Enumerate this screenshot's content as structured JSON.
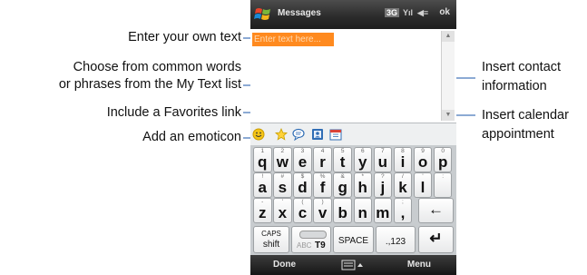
{
  "callouts": {
    "enter_text": "Enter your own text",
    "my_text_line1": "Choose from common words",
    "my_text_line2": "or phrases from the My Text list",
    "favorites": "Include a Favorites link",
    "emoticon": "Add an emoticon",
    "contact_line1": "Insert contact",
    "contact_line2": "information",
    "calendar_line1": "Insert calendar",
    "calendar_line2": "appointment"
  },
  "phone": {
    "title": "Messages",
    "network": "3G",
    "signal": "Yıl",
    "volume": "◀≡",
    "ok": "ok",
    "compose_placeholder": "Enter text here...",
    "done": "Done",
    "menu": "Menu"
  },
  "keyboard": {
    "row1": [
      {
        "alt": "1",
        "main": "q"
      },
      {
        "alt": "2",
        "main": "w"
      },
      {
        "alt": "3",
        "main": "e"
      },
      {
        "alt": "4",
        "main": "r"
      },
      {
        "alt": "5",
        "main": "t"
      },
      {
        "alt": "6",
        "main": "y"
      },
      {
        "alt": "7",
        "main": "u"
      },
      {
        "alt": "8",
        "main": "i"
      },
      {
        "alt": "9",
        "main": "o"
      },
      {
        "alt": "0",
        "main": "p"
      }
    ],
    "row2": [
      {
        "alt": "!",
        "main": "a"
      },
      {
        "alt": "#",
        "main": "s"
      },
      {
        "alt": "$",
        "main": "d"
      },
      {
        "alt": "%",
        "main": "f"
      },
      {
        "alt": "&",
        "main": "g"
      },
      {
        "alt": "*",
        "main": "h"
      },
      {
        "alt": "?",
        "main": "j"
      },
      {
        "alt": "/",
        "main": "k"
      },
      {
        "alt": "'",
        "main": "l"
      },
      {
        "alt": ":",
        "main": ""
      }
    ],
    "row3": [
      {
        "alt": "-",
        "main": "z"
      },
      {
        "alt": "'",
        "main": "x"
      },
      {
        "alt": "(",
        "main": "c"
      },
      {
        "alt": ")",
        "main": "v"
      },
      {
        "alt": "",
        "main": "b"
      },
      {
        "alt": "",
        "main": "n"
      },
      {
        "alt": "",
        "main": "m"
      },
      {
        "alt": ";",
        "main": ","
      }
    ],
    "caps_top": "CAPS",
    "caps_bottom": "shift",
    "abc_label": "ABC",
    "t9_label": "T9",
    "space": "SPACE",
    "num": ".,123",
    "backspace": "←",
    "enter": "↵"
  },
  "colors": {
    "highlight": "#ff8a1f",
    "titlebar": "#2a2a2a",
    "callout_line": "#1a56a8"
  },
  "icons": [
    "windows-logo-icon",
    "emoticon-icon",
    "favorites-star-icon",
    "my-text-icon",
    "contact-icon",
    "calendar-icon",
    "keyboard-icon"
  ]
}
